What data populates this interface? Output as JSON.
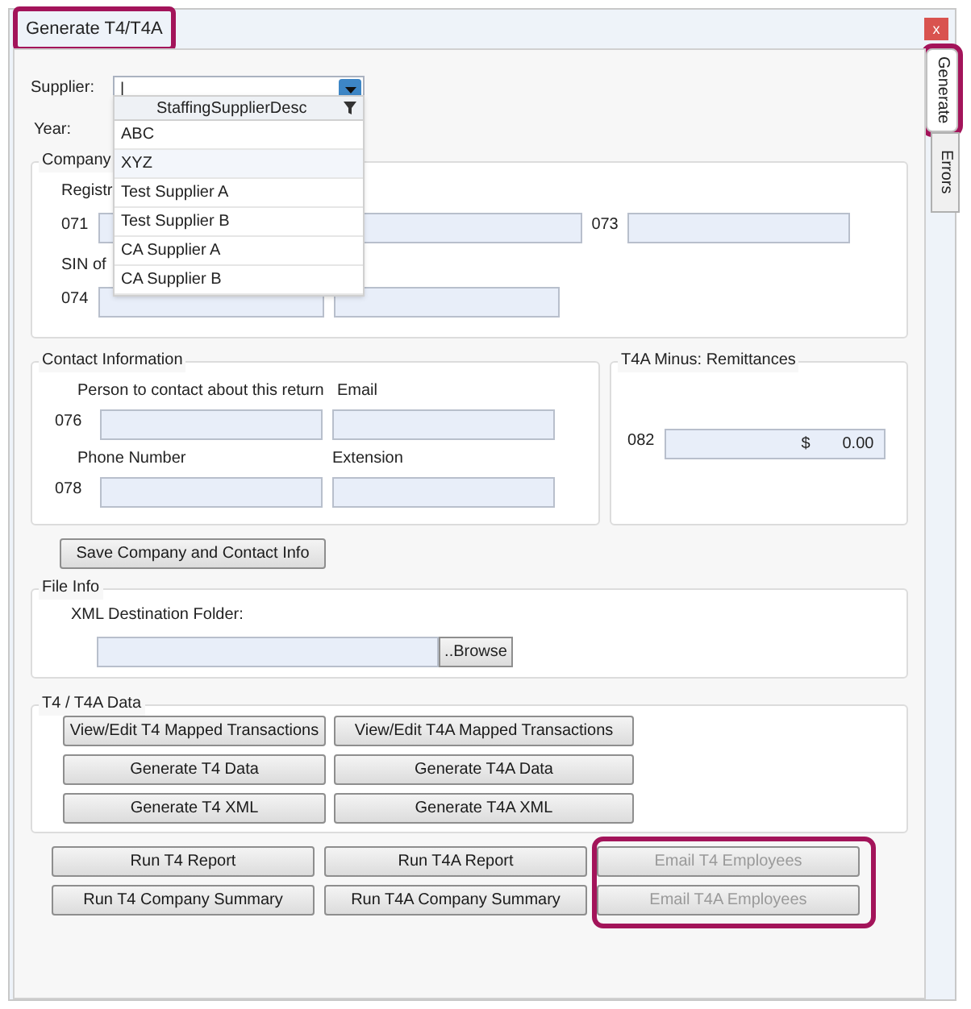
{
  "window": {
    "title": "Generate T4/T4A",
    "title_highlighted": true,
    "close": "x"
  },
  "tabs": [
    {
      "label": "Generate",
      "selected": true,
      "highlighted": true
    },
    {
      "label": "Errors",
      "selected": false,
      "highlighted": false
    }
  ],
  "supplier": {
    "label": "Supplier:",
    "value": "|",
    "dropdown": {
      "expanded": true,
      "column": "StaffingSupplierDesc",
      "items": [
        {
          "label": "ABC",
          "hovered": false
        },
        {
          "label": "XYZ",
          "hovered": true
        },
        {
          "label": "Test Supplier A",
          "hovered": false
        },
        {
          "label": "Test Supplier B",
          "hovered": false
        },
        {
          "label": "CA Supplier A",
          "hovered": false
        },
        {
          "label": "CA Supplier B",
          "hovered": false
        }
      ]
    }
  },
  "year": {
    "label": "Year:"
  },
  "company": {
    "legend": "Company",
    "label_1": "Registr",
    "code_1": "071",
    "code_2": "073",
    "label_2": "SIN of",
    "code_3": "074"
  },
  "contact": {
    "legend": "Contact Information",
    "person_label": "Person to contact about this return",
    "email_label": "Email",
    "code_1": "076",
    "phone_label": "Phone Number",
    "extension_label": "Extension",
    "code_2": "078"
  },
  "remittances": {
    "legend": "T4A Minus: Remittances",
    "code": "082",
    "currency": "$",
    "value": "0.00"
  },
  "save_button": "Save Company and Contact Info",
  "file_info": {
    "legend": "File Info",
    "folder_label": "XML Destination Folder:",
    "browse": "..Browse"
  },
  "data_group": {
    "legend": "T4 / T4A Data",
    "buttons": [
      [
        "View/Edit T4 Mapped Transactions",
        "View/Edit T4A Mapped Transactions"
      ],
      [
        "Generate T4 Data",
        "Generate T4A Data"
      ],
      [
        "Generate T4 XML",
        "Generate T4A XML"
      ]
    ]
  },
  "bottom_buttons": [
    [
      {
        "label": "Run T4 Report",
        "disabled": false
      },
      {
        "label": "Run T4A Report",
        "disabled": false
      },
      {
        "label": "Email T4 Employees",
        "disabled": true
      }
    ],
    [
      {
        "label": "Run T4 Company Summary",
        "disabled": false
      },
      {
        "label": "Run T4A Company Summary",
        "disabled": false
      },
      {
        "label": "Email T4A Employees",
        "disabled": true
      }
    ]
  ],
  "email_highlighted": true
}
